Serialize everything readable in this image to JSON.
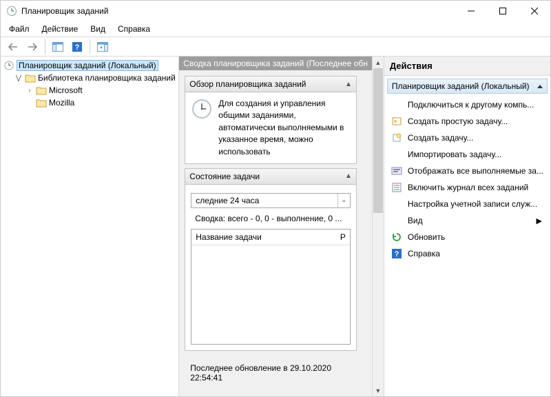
{
  "window": {
    "title": "Планировщик заданий"
  },
  "menu": {
    "file": "Файл",
    "action": "Действие",
    "view": "Вид",
    "help": "Справка"
  },
  "tree": {
    "root": "Планировщик заданий (Локальный)",
    "library": "Библиотека планировщика заданий",
    "microsoft": "Microsoft",
    "mozilla": "Mozilla"
  },
  "center": {
    "header": "Сводка планировщика заданий (Последнее обн",
    "overview_title": "Обзор планировщика заданий",
    "overview_text": "Для создания и управления общими заданиями, автоматически выполняемыми в указанное время, можно использовать",
    "status_title": "Состояние задачи",
    "status_combo": "следние 24 часа",
    "summary": "Сводка: всего - 0, 0 - выполнение, 0 ...",
    "col_name": "Название задачи",
    "col_result": "Р",
    "footer": "Последнее обновление в 29.10.2020 22:54:41"
  },
  "actions": {
    "header": "Действия",
    "subheader": "Планировщик заданий (Локальный)",
    "items": {
      "connect": "Подключиться к другому компь...",
      "createBasic": "Создать простую задачу...",
      "create": "Создать задачу...",
      "import": "Импортировать задачу...",
      "showRunning": "Отображать все выполняемые за...",
      "enableHistory": "Включить журнал всех заданий",
      "accountConfig": "Настройка учетной записи служ...",
      "view": "Вид",
      "refresh": "Обновить",
      "help": "Справка"
    }
  }
}
